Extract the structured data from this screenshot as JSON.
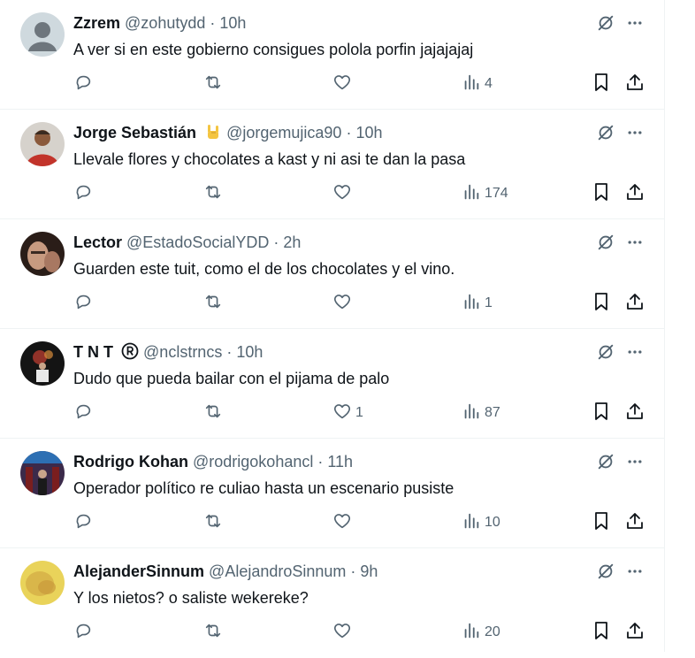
{
  "replies": [
    {
      "name": "Zzrem",
      "handle": "@zohutydd",
      "time": "10h",
      "badge": "",
      "text": "A ver si en este gobierno consigues polola porfin jajajajaj",
      "replies_count": "",
      "reposts": "",
      "likes": "",
      "views": "4",
      "avatar": "default"
    },
    {
      "name": "Jorge Sebastián",
      "handle": "@jorgemujica90",
      "time": "10h",
      "badge": "rock-hand-emoji",
      "text": "Llevale flores y chocolates a kast y ni asi te dan la pasa",
      "replies_count": "",
      "reposts": "",
      "likes": "",
      "views": "174",
      "avatar": "photo-man-red"
    },
    {
      "name": "Lector",
      "handle": "@EstadoSocialYDD",
      "time": "2h",
      "badge": "",
      "text": "Guarden este tuit, como el de los chocolates y el vino.",
      "replies_count": "",
      "reposts": "",
      "likes": "",
      "views": "1",
      "avatar": "photo-face"
    },
    {
      "name": "T N T",
      "handle": "@nclstrncs",
      "time": "10h",
      "badge": "registered-mark",
      "text": "Dudo que pueda bailar con el pijama de palo",
      "replies_count": "",
      "reposts": "",
      "likes": "1",
      "views": "87",
      "avatar": "photo-dark"
    },
    {
      "name": "Rodrigo Kohan",
      "handle": "@rodrigokohancl",
      "time": "11h",
      "badge": "",
      "text": "Operador político re culiao hasta un escenario pusiste",
      "replies_count": "",
      "reposts": "",
      "likes": "",
      "views": "10",
      "avatar": "photo-stage"
    },
    {
      "name": "AlejanderSinnum",
      "handle": "@AlejandroSinnum",
      "time": "9h",
      "badge": "",
      "text": "Y los nietos? o saliste wekereke?",
      "replies_count": "",
      "reposts": "",
      "likes": "",
      "views": "20",
      "avatar": "photo-yellow"
    }
  ],
  "separator": "·",
  "colors": {
    "text": "#0f1419",
    "secondary": "#536471",
    "border": "#eff3f4"
  }
}
